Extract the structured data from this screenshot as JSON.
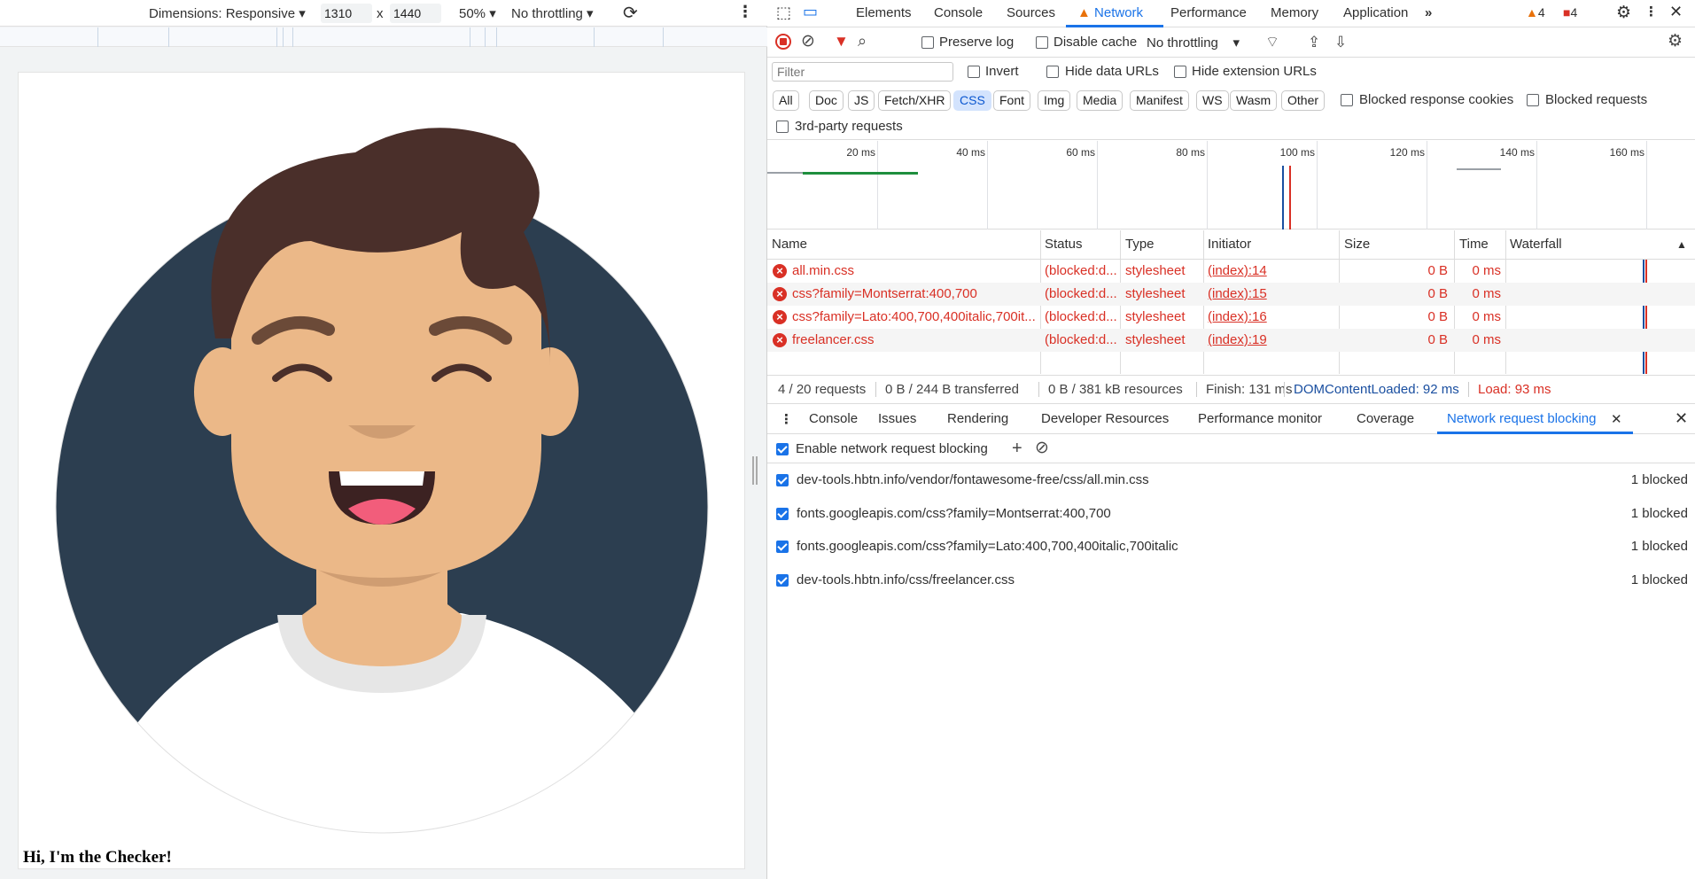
{
  "device_toolbar": {
    "dimensions_label": "Dimensions: Responsive",
    "width": "1310",
    "times": "x",
    "height": "1440",
    "zoom": "50%",
    "throttling": "No throttling"
  },
  "page": {
    "heading": "Hi, I'm the Checker!"
  },
  "devtools_tabs": [
    "Elements",
    "Console",
    "Sources",
    "Network",
    "Performance",
    "Memory",
    "Application"
  ],
  "warnings_count": "4",
  "errors_count": "4",
  "network_toolbar": {
    "preserve_log": "Preserve log",
    "disable_cache": "Disable cache",
    "throttling": "No throttling"
  },
  "filter": {
    "placeholder": "Filter",
    "invert": "Invert",
    "hide_data_urls": "Hide data URLs",
    "hide_extension_urls": "Hide extension URLs"
  },
  "type_filters": [
    "All",
    "Doc",
    "JS",
    "Fetch/XHR",
    "CSS",
    "Font",
    "Img",
    "Media",
    "Manifest",
    "WS",
    "Wasm",
    "Other"
  ],
  "type_filters_selected": "CSS",
  "blocked_response_cookies": "Blocked response cookies",
  "blocked_requests": "Blocked requests",
  "third_party": "3rd-party requests",
  "timeline_ticks": [
    "20 ms",
    "40 ms",
    "60 ms",
    "80 ms",
    "100 ms",
    "120 ms",
    "140 ms",
    "160 ms"
  ],
  "table": {
    "headers": [
      "Name",
      "Status",
      "Type",
      "Initiator",
      "Size",
      "Time",
      "Waterfall"
    ],
    "rows": [
      {
        "name": "all.min.css",
        "status": "(blocked:d...",
        "type": "stylesheet",
        "initiator": "(index):14",
        "size": "0 B",
        "time": "0 ms"
      },
      {
        "name": "css?family=Montserrat:400,700",
        "status": "(blocked:d...",
        "type": "stylesheet",
        "initiator": "(index):15",
        "size": "0 B",
        "time": "0 ms"
      },
      {
        "name": "css?family=Lato:400,700,400italic,700it...",
        "status": "(blocked:d...",
        "type": "stylesheet",
        "initiator": "(index):16",
        "size": "0 B",
        "time": "0 ms"
      },
      {
        "name": "freelancer.css",
        "status": "(blocked:d...",
        "type": "stylesheet",
        "initiator": "(index):19",
        "size": "0 B",
        "time": "0 ms"
      }
    ]
  },
  "summary": {
    "requests": "4 / 20 requests",
    "transferred": "0 B / 244 B transferred",
    "resources": "0 B / 381 kB resources",
    "finish": "Finish: 131 ms",
    "dom_loaded": "DOMContentLoaded: 92 ms",
    "load": "Load: 93 ms",
    "dom_color": "#1a4fa0",
    "load_color": "#d93025"
  },
  "drawer_tabs": [
    "Console",
    "Issues",
    "Rendering",
    "Developer Resources",
    "Performance monitor",
    "Coverage",
    "Network request blocking"
  ],
  "blocking": {
    "enable_label": "Enable network request blocking",
    "patterns": [
      {
        "url": "dev-tools.hbtn.info/vendor/fontawesome-free/css/all.min.css",
        "count": "1 blocked"
      },
      {
        "url": "fonts.googleapis.com/css?family=Montserrat:400,700",
        "count": "1 blocked"
      },
      {
        "url": "fonts.googleapis.com/css?family=Lato:400,700,400italic,700italic",
        "count": "1 blocked"
      },
      {
        "url": "dev-tools.hbtn.info/css/freelancer.css",
        "count": "1 blocked"
      }
    ]
  },
  "colors": {
    "accent": "#1a73e8",
    "error": "#d93025",
    "avatar_bg": "#2c3e50",
    "skin": "#ebb888",
    "hair": "#4a2f2a"
  }
}
